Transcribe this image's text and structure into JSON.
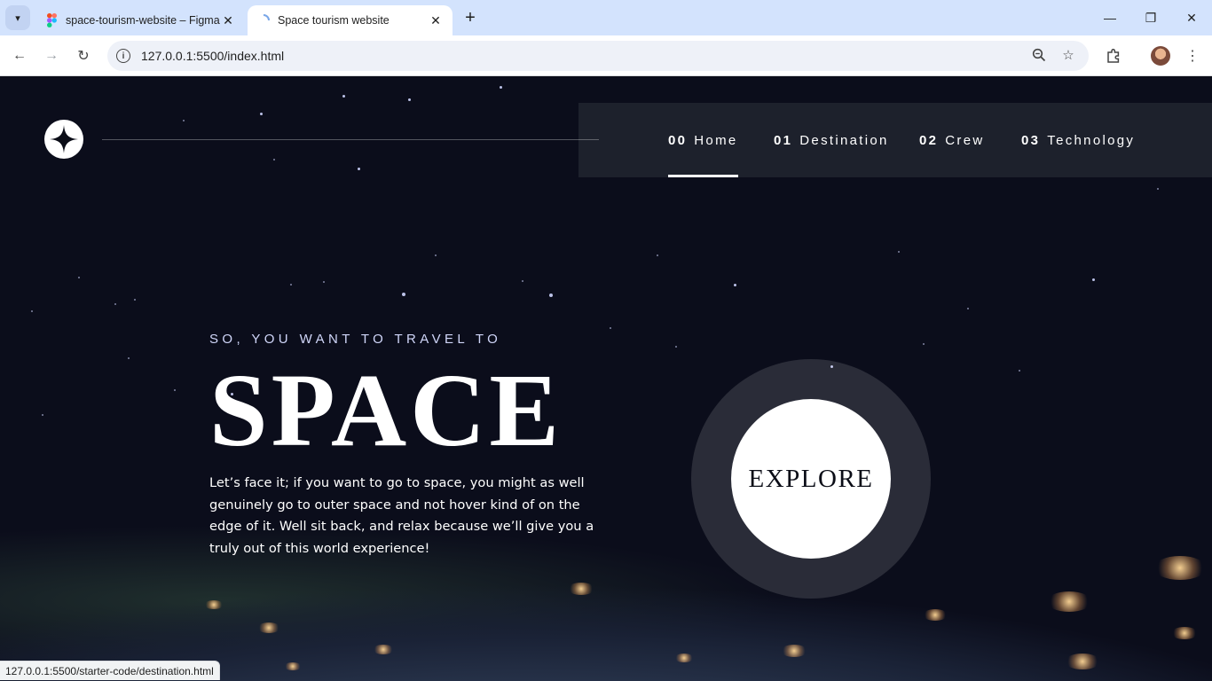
{
  "browser": {
    "tabs": [
      {
        "title": "space-tourism-website – Figma",
        "icon": "figma-icon"
      },
      {
        "title": "Space tourism website",
        "icon": "loading-icon"
      }
    ],
    "url": "127.0.0.1:5500/index.html",
    "status_url": "127.0.0.1:5500/starter-code/destination.html"
  },
  "nav": {
    "items": [
      {
        "num": "00",
        "label": "Home"
      },
      {
        "num": "01",
        "label": "Destination"
      },
      {
        "num": "02",
        "label": "Crew"
      },
      {
        "num": "03",
        "label": "Technology"
      }
    ],
    "active": "Home"
  },
  "hero": {
    "eyebrow": "SO, YOU WANT TO TRAVEL TO",
    "title": "SPACE",
    "text": "Let’s face it; if you want to go to space, you might as well genuinely go to outer space and not hover kind of on the edge of it. Well sit back, and relax because we’ll give you a truly out of this world experience!",
    "cta": "EXPLORE"
  },
  "colors": {
    "background": "#0b0d17",
    "accent": "#d0d6f9",
    "white": "#ffffff"
  }
}
